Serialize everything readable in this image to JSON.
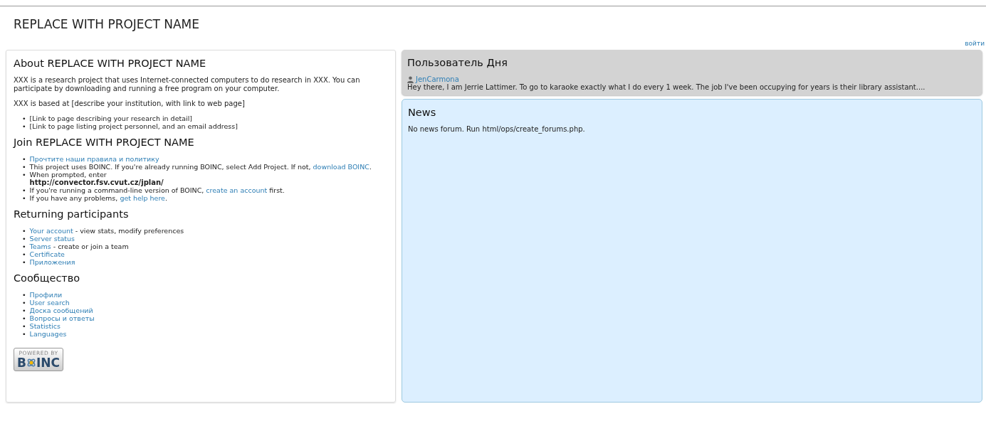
{
  "header": {
    "title": "REPLACE WITH PROJECT NAME",
    "login_link": "войти"
  },
  "left": {
    "list_marker": "•",
    "sections": [
      {
        "heading": "About REPLACE WITH PROJECT NAME",
        "paragraphs": [
          "XXX is a research project that uses Internet-connected computers to do research in XXX. You can participate by downloading and running a free program on your computer.",
          "XXX is based at [describe your institution, with link to web page]"
        ],
        "items": [
          [
            {
              "kind": "text",
              "text": "[Link to page describing your research in detail]"
            }
          ],
          [
            {
              "kind": "text",
              "text": "[Link to page listing project personnel, and an email address]"
            }
          ]
        ]
      },
      {
        "heading": "Join REPLACE WITH PROJECT NAME",
        "items": [
          [
            {
              "kind": "link",
              "text": "Прочтите наши правила и политику"
            }
          ],
          [
            {
              "kind": "text",
              "text": "This project uses BOINC. If you're already running BOINC, select Add Project. If not, "
            },
            {
              "kind": "link",
              "text": "download BOINC"
            },
            {
              "kind": "text",
              "text": "."
            }
          ],
          [
            {
              "kind": "text",
              "text": "When prompted, enter"
            },
            {
              "kind": "url",
              "text": "http://convector.fsv.cvut.cz/jplan/"
            }
          ],
          [
            {
              "kind": "text",
              "text": "If you're running a command-line version of BOINC, "
            },
            {
              "kind": "link",
              "text": "create an account"
            },
            {
              "kind": "text",
              "text": " first."
            }
          ],
          [
            {
              "kind": "text",
              "text": "If you have any problems, "
            },
            {
              "kind": "link",
              "text": "get help here"
            },
            {
              "kind": "text",
              "text": "."
            }
          ]
        ]
      },
      {
        "heading": "Returning participants",
        "items": [
          [
            {
              "kind": "link",
              "text": "Your account"
            },
            {
              "kind": "text",
              "text": " - view stats, modify preferences"
            }
          ],
          [
            {
              "kind": "link",
              "text": "Server status"
            }
          ],
          [
            {
              "kind": "link",
              "text": "Teams"
            },
            {
              "kind": "text",
              "text": " - create or join a team"
            }
          ],
          [
            {
              "kind": "link",
              "text": "Certificate"
            }
          ],
          [
            {
              "kind": "link",
              "text": "Приложения"
            }
          ]
        ]
      },
      {
        "heading": "Сообщество",
        "items": [
          [
            {
              "kind": "link",
              "text": "Профили"
            }
          ],
          [
            {
              "kind": "link",
              "text": "User search"
            }
          ],
          [
            {
              "kind": "link",
              "text": "Доска сообщений"
            }
          ],
          [
            {
              "kind": "link",
              "text": "Вопросы и ответы"
            }
          ],
          [
            {
              "kind": "link",
              "text": "Statistics"
            }
          ],
          [
            {
              "kind": "link",
              "text": "Languages"
            }
          ]
        ]
      }
    ],
    "badge": {
      "top": "POWERED BY",
      "left": "B",
      "right": "INC"
    }
  },
  "user_of_day": {
    "heading": "Пользователь Дня",
    "user": "JenCarmona",
    "text": "Hey there, I am Jerrie Lattimer. To go to karaoke exactly what I do every 1 week. The job I've been occupying for years is their library assistant...."
  },
  "news": {
    "heading": "News",
    "text": "No news forum. Run html/ops/create_forums.php."
  }
}
